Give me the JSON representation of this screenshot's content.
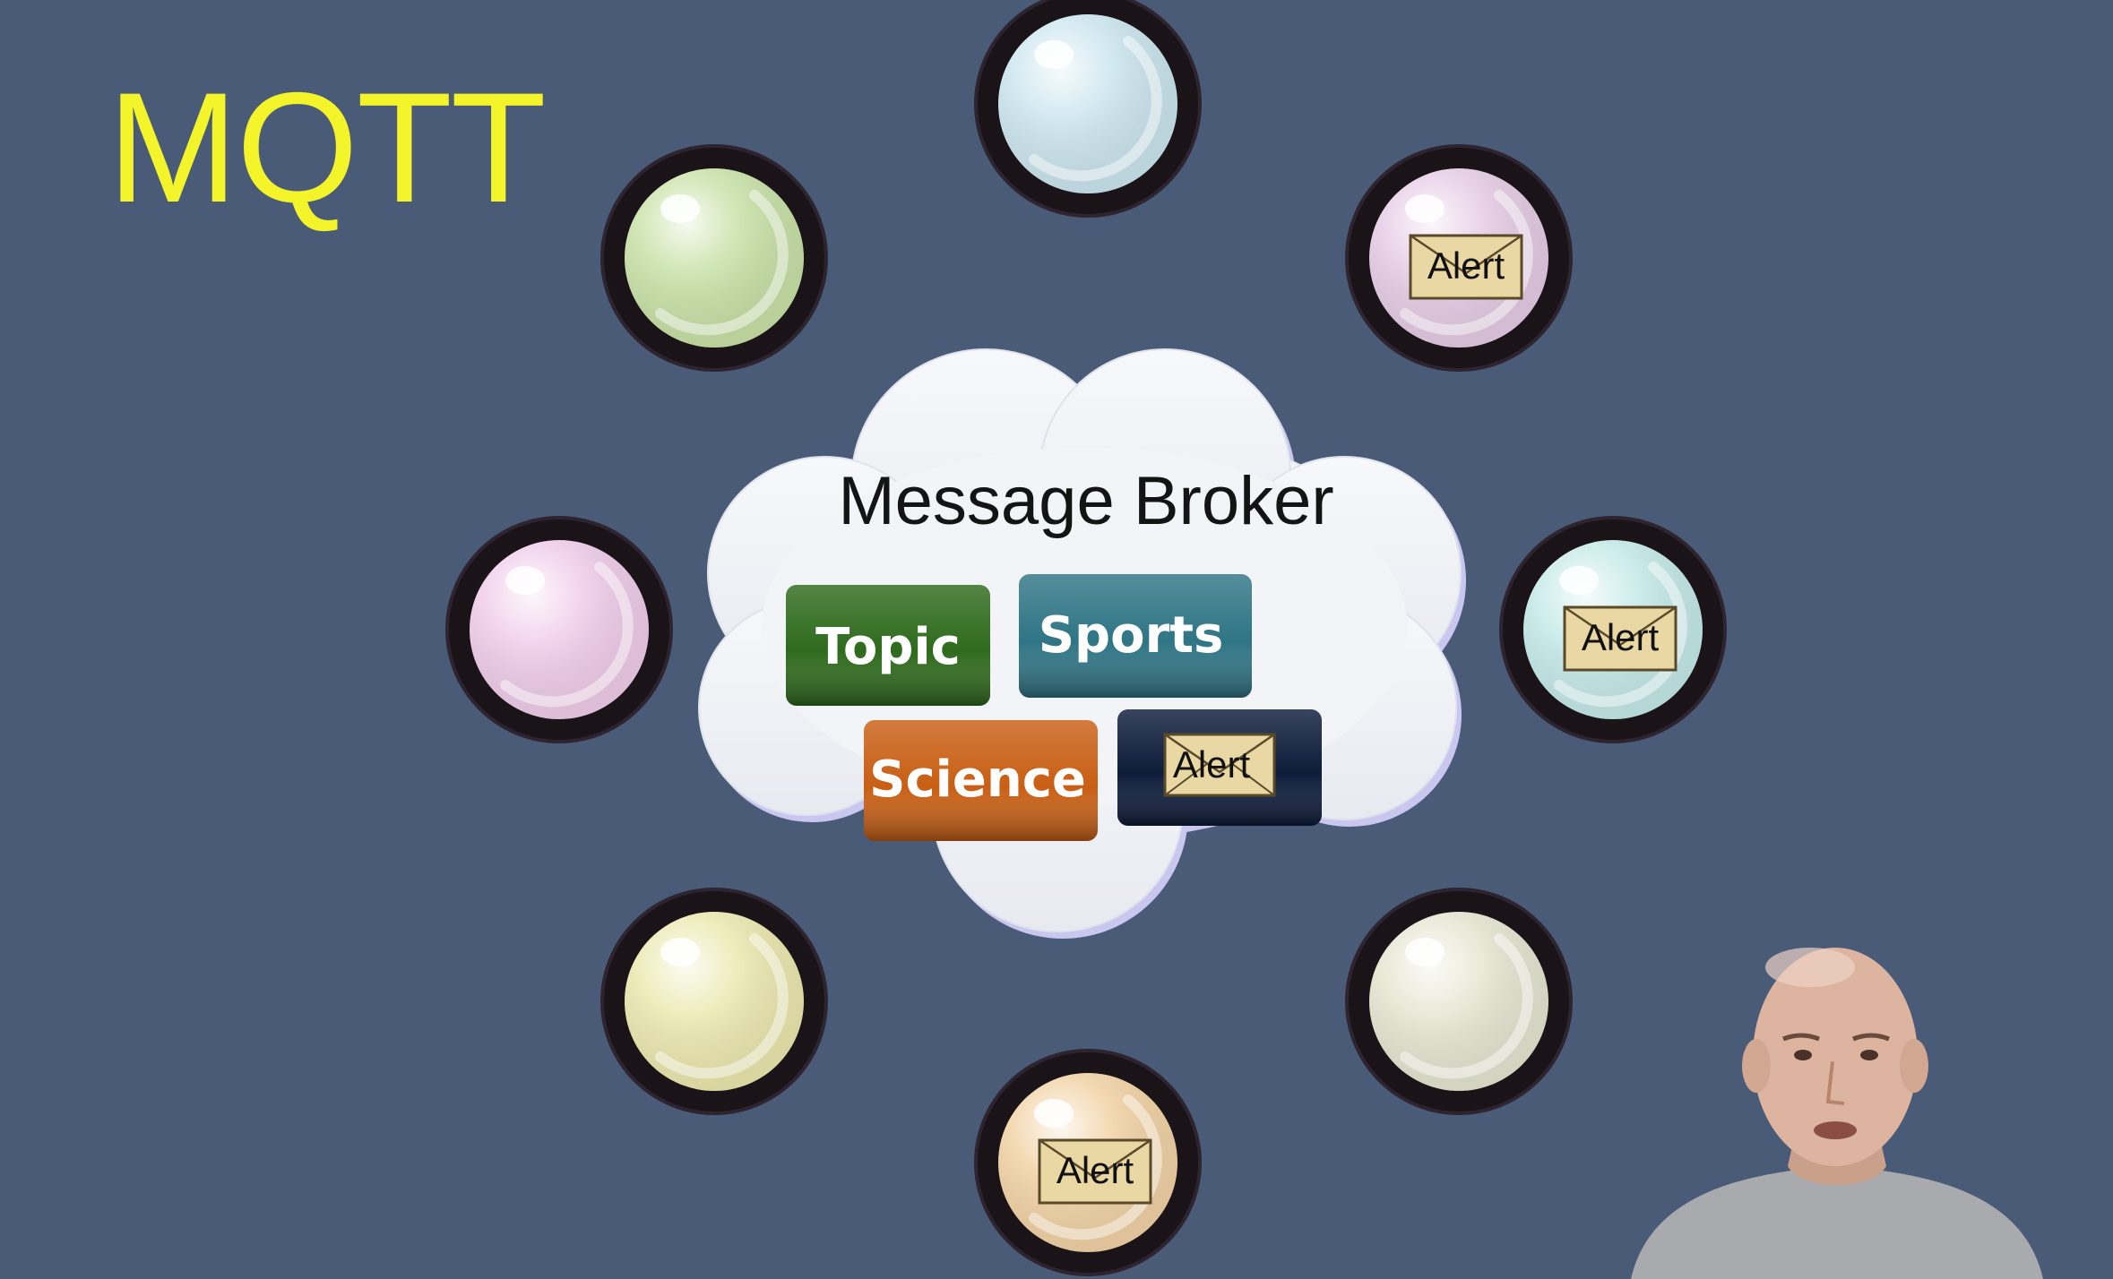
{
  "slide": {
    "title": "MQTT"
  },
  "broker": {
    "title": "Message Broker",
    "topics": [
      {
        "label": "Topic",
        "color": "#2e6a1c",
        "kind": "text"
      },
      {
        "label": "Sports",
        "color": "#2f7585",
        "kind": "text"
      },
      {
        "label": "Science",
        "color": "#c85f14",
        "kind": "text"
      },
      {
        "label": "Alert",
        "color": "#0d1c3a",
        "kind": "envelope"
      }
    ]
  },
  "clients": [
    {
      "id": "top",
      "color": "#cce6ef",
      "envelope": null
    },
    {
      "id": "upper-left",
      "color": "#c9e2a8",
      "envelope": null
    },
    {
      "id": "upper-right",
      "color": "#e6cde6",
      "envelope": "Alert"
    },
    {
      "id": "left",
      "color": "#f0cdea",
      "envelope": null
    },
    {
      "id": "right",
      "color": "#c5eae8",
      "envelope": "Alert"
    },
    {
      "id": "lower-left",
      "color": "#ece9b0",
      "envelope": null
    },
    {
      "id": "lower-right",
      "color": "#e6e6d2",
      "envelope": null
    },
    {
      "id": "bottom",
      "color": "#f2d3a6",
      "envelope": "Alert"
    }
  ],
  "colors": {
    "background": "#4a5b78",
    "title": "#f4f42a",
    "client_ring": "#1a1418",
    "envelope": "#e9d7a4"
  },
  "presenter": {
    "icon": "presenter-video"
  }
}
